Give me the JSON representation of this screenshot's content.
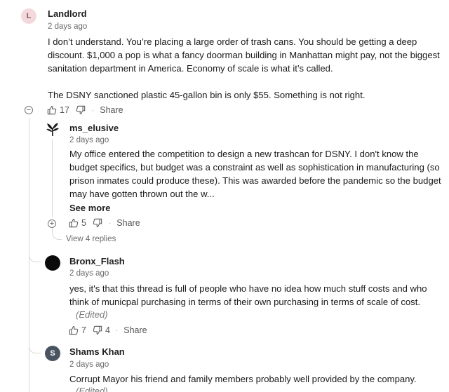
{
  "comments": [
    {
      "avatar_letter": "L",
      "username": "Landlord",
      "time": "2 days ago",
      "lines": [
        "I don’t understand. You’re placing a large order of trash cans. You should be getting a deep",
        "discount. $1,000 a pop is what a fancy doorman building in Manhattan might pay, not the biggest",
        "sanitation department in America. Economy of scale is what it’s called.",
        "",
        "The DSNY sanctioned plastic 45-gallon bin is only $55. Something is not right."
      ],
      "likes": "17",
      "share_label": "Share",
      "toggle": "−"
    },
    {
      "username": "ms_elusive",
      "time": "2 days ago",
      "lines": [
        "My office entered the competition to design a new trashcan for DSNY. I don't know the",
        "budget specifics, but budget was a constraint as well as sophistication in manufacturing (so",
        "prison inmates could produce these). This was awarded before the pandemic so the budget",
        "may have gotten thrown out the w..."
      ],
      "see_more": "See more",
      "likes": "5",
      "share_label": "Share",
      "toggle": "+",
      "view_replies": "View 4 replies"
    },
    {
      "username": "Bronx_Flash",
      "time": "2 days ago",
      "lines": [
        "yes, it's that this thread is full of people who have no idea how much stuff costs and who",
        "think of municpal purchasing in terms of their own purchasing in terms of scale of cost."
      ],
      "edited": "(Edited)",
      "likes": "7",
      "dislikes": "4",
      "share_label": "Share"
    },
    {
      "avatar_letter": "S",
      "username": "Shams Khan",
      "time": "2 days ago",
      "lines": [
        "Corrupt Mayor his friend and family members probably well provided by the company."
      ],
      "edited": "(Edited)"
    }
  ],
  "icons": {
    "like": "thumbs-up-icon",
    "dislike": "thumbs-down-icon"
  },
  "colors": {
    "avatar_l_bg": "#f3d9dc",
    "avatar_s_bg": "#4a5360",
    "thread_line": "#d8d8d8"
  }
}
